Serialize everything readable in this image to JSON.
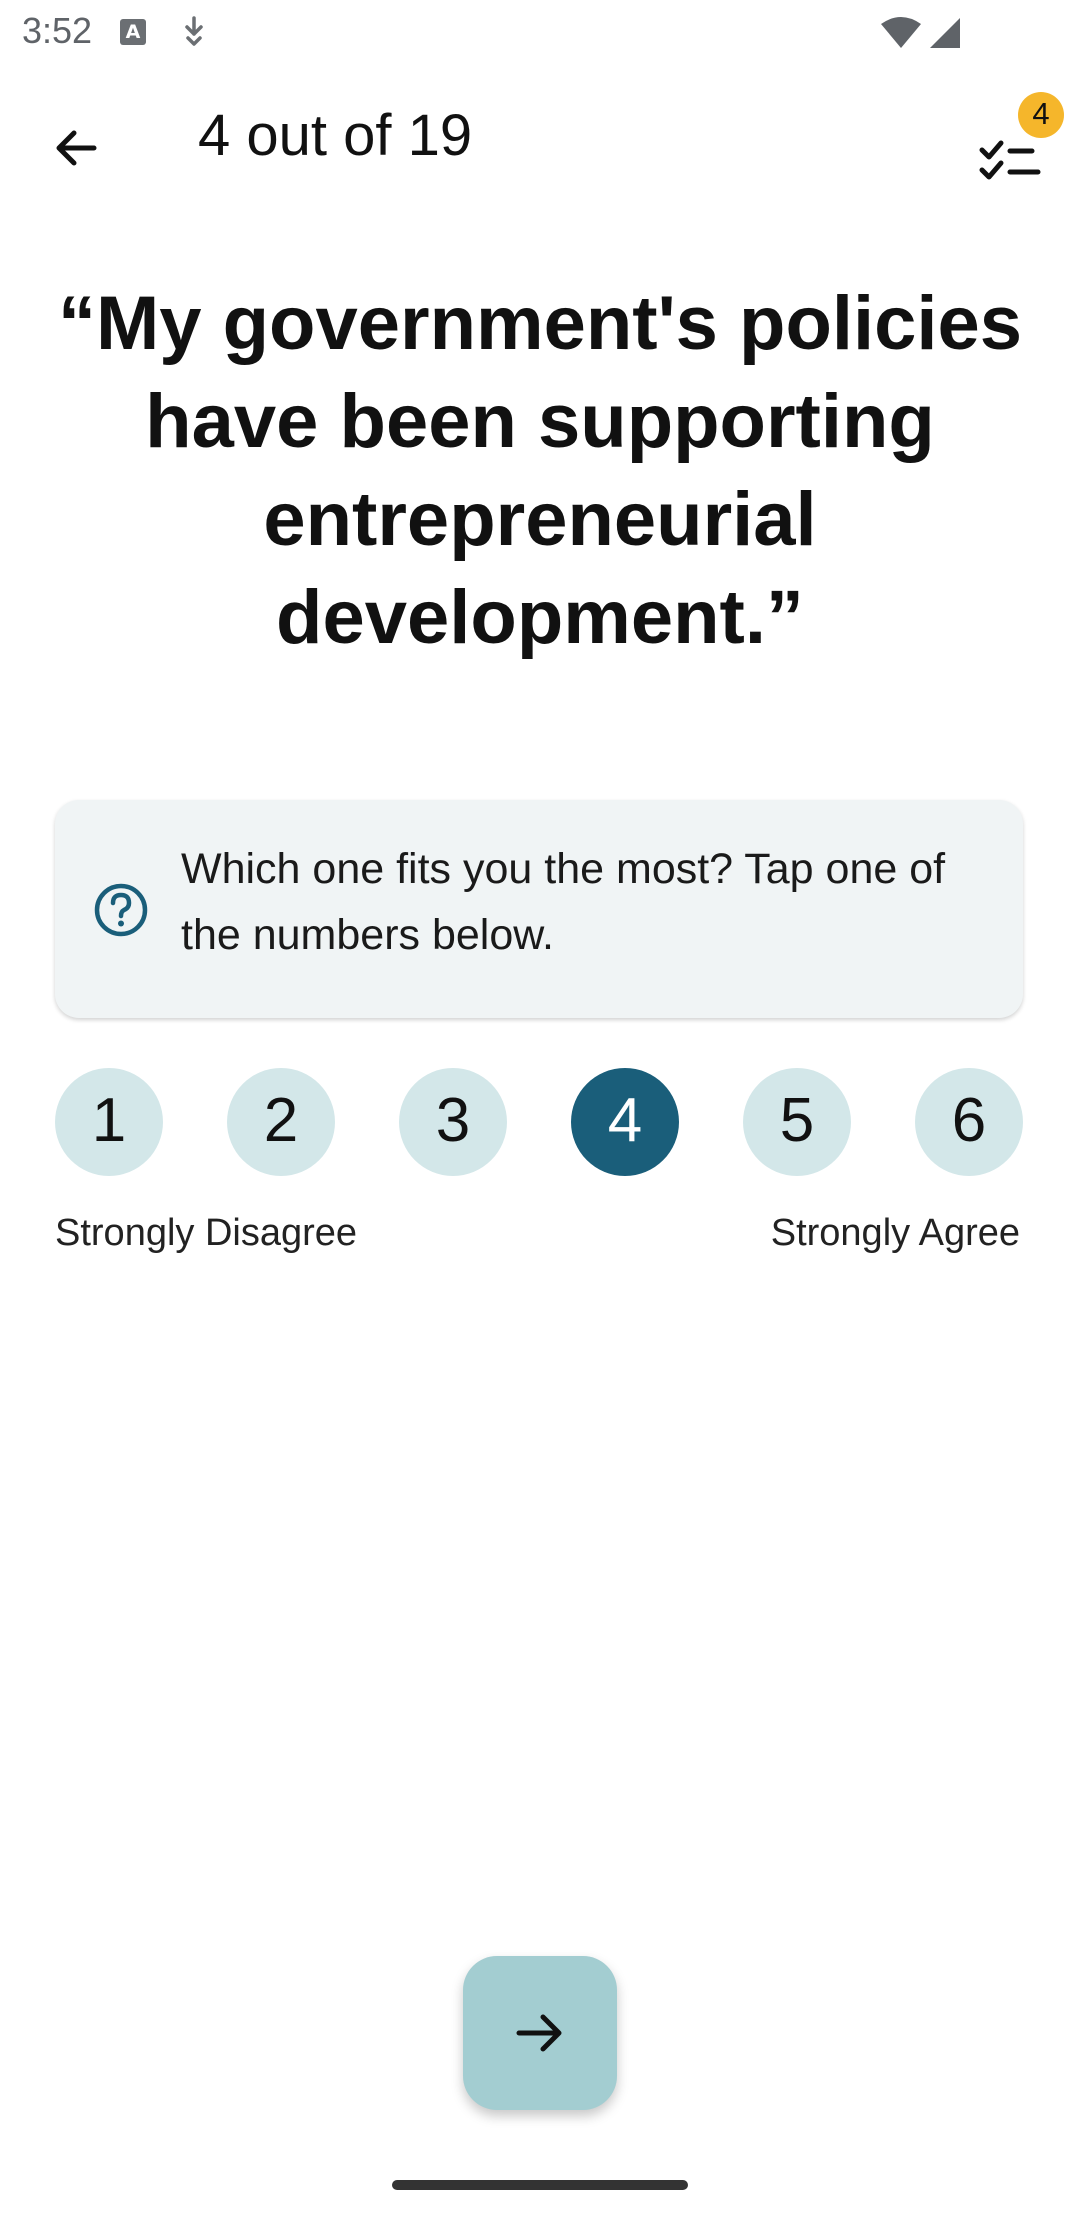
{
  "status_bar": {
    "time": "3:52",
    "notification_icons": [
      "app-a-icon",
      "download-icon"
    ],
    "system_icons": [
      "wifi-icon",
      "cell-signal-icon"
    ]
  },
  "app_bar": {
    "back_icon": "arrow-back-icon",
    "progress_text": "4 out of 19",
    "checklist_icon": "checklist-icon",
    "checklist_badge": "4",
    "badge_color": "#f5b62b"
  },
  "question": {
    "statement": "“My government's policies have been supporting entrepreneurial development.”"
  },
  "hint": {
    "icon": "help-circle-icon",
    "text": "Which one fits you the most? Tap one of the numbers below."
  },
  "scale": {
    "options": [
      "1",
      "2",
      "3",
      "4",
      "5",
      "6"
    ],
    "selected": "4",
    "label_min": "Strongly Disagree",
    "label_max": "Strongly Agree",
    "option_color": "#d3e7e9",
    "selected_color": "#1a5e7a"
  },
  "navigation": {
    "next_icon": "arrow-forward-icon",
    "next_button_color": "#a3cdd1"
  }
}
